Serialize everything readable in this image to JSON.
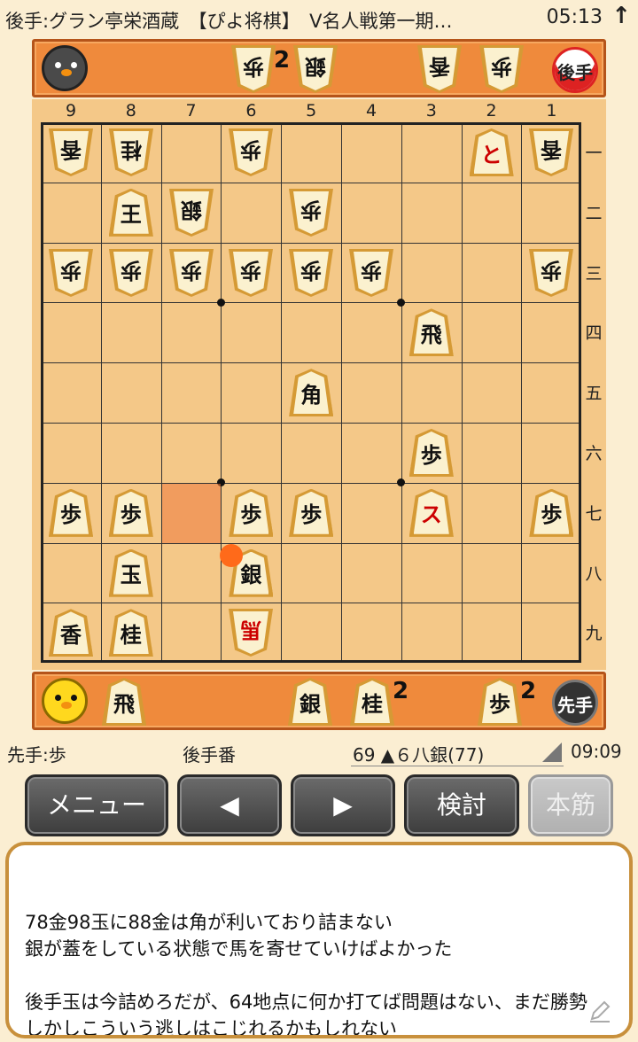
{
  "status_bar": {
    "title": "後手:グラン亭栄酒蔵　【ぴよ将棋】　V名人戦第一期…",
    "time": "05:13",
    "up_icon": "up-arrow-icon"
  },
  "gote": {
    "badge": "後手",
    "hand": [
      {
        "piece": "歩",
        "count": "2"
      },
      {
        "piece": "銀",
        "count": ""
      },
      {
        "piece": "香",
        "count": ""
      },
      {
        "piece": "歩",
        "count": ""
      }
    ]
  },
  "sente": {
    "badge": "先手",
    "hand": [
      {
        "piece": "飛",
        "count": ""
      },
      {
        "piece": "銀",
        "count": ""
      },
      {
        "piece": "桂",
        "count": "2"
      },
      {
        "piece": "歩",
        "count": "2"
      }
    ]
  },
  "board": {
    "files": [
      "9",
      "8",
      "7",
      "6",
      "5",
      "4",
      "3",
      "2",
      "1"
    ],
    "ranks": [
      "一",
      "二",
      "三",
      "四",
      "五",
      "六",
      "七",
      "八",
      "九"
    ],
    "pieces": [
      {
        "file": 9,
        "rank": 1,
        "text": "香",
        "owner": "gote"
      },
      {
        "file": 8,
        "rank": 1,
        "text": "桂",
        "owner": "gote"
      },
      {
        "file": 6,
        "rank": 1,
        "text": "歩",
        "owner": "gote"
      },
      {
        "file": 2,
        "rank": 1,
        "text": "と",
        "owner": "sente",
        "promoted": true
      },
      {
        "file": 1,
        "rank": 1,
        "text": "香",
        "owner": "gote"
      },
      {
        "file": 8,
        "rank": 2,
        "text": "王",
        "owner": "sente"
      },
      {
        "file": 7,
        "rank": 2,
        "text": "銀",
        "owner": "gote"
      },
      {
        "file": 5,
        "rank": 2,
        "text": "歩",
        "owner": "gote"
      },
      {
        "file": 9,
        "rank": 3,
        "text": "歩",
        "owner": "gote"
      },
      {
        "file": 8,
        "rank": 3,
        "text": "歩",
        "owner": "gote"
      },
      {
        "file": 7,
        "rank": 3,
        "text": "歩",
        "owner": "gote"
      },
      {
        "file": 6,
        "rank": 3,
        "text": "歩",
        "owner": "gote"
      },
      {
        "file": 5,
        "rank": 3,
        "text": "歩",
        "owner": "gote"
      },
      {
        "file": 4,
        "rank": 3,
        "text": "歩",
        "owner": "gote"
      },
      {
        "file": 1,
        "rank": 3,
        "text": "歩",
        "owner": "gote"
      },
      {
        "file": 3,
        "rank": 4,
        "text": "飛",
        "owner": "sente"
      },
      {
        "file": 5,
        "rank": 5,
        "text": "角",
        "owner": "sente"
      },
      {
        "file": 3,
        "rank": 6,
        "text": "歩",
        "owner": "sente"
      },
      {
        "file": 9,
        "rank": 7,
        "text": "歩",
        "owner": "sente"
      },
      {
        "file": 8,
        "rank": 7,
        "text": "歩",
        "owner": "sente"
      },
      {
        "file": 6,
        "rank": 7,
        "text": "歩",
        "owner": "sente"
      },
      {
        "file": 5,
        "rank": 7,
        "text": "歩",
        "owner": "sente"
      },
      {
        "file": 3,
        "rank": 7,
        "text": "ス",
        "owner": "sente",
        "promoted": true
      },
      {
        "file": 1,
        "rank": 7,
        "text": "歩",
        "owner": "sente"
      },
      {
        "file": 8,
        "rank": 8,
        "text": "玉",
        "owner": "sente"
      },
      {
        "file": 6,
        "rank": 8,
        "text": "銀",
        "owner": "sente"
      },
      {
        "file": 9,
        "rank": 9,
        "text": "香",
        "owner": "sente"
      },
      {
        "file": 8,
        "rank": 9,
        "text": "桂",
        "owner": "sente"
      },
      {
        "file": 6,
        "rank": 9,
        "text": "馬",
        "owner": "gote",
        "promoted": true
      }
    ],
    "highlight": {
      "file": 7,
      "rank": 7
    },
    "colors": {
      "board": "#f4c888",
      "highlight": "#ee783c",
      "tray": "#ef8a3c"
    }
  },
  "info": {
    "hand_text": "先手:歩",
    "turn_text": "後手番",
    "move_text": "69 ▲６八銀(77)",
    "clock": "09:09"
  },
  "buttons": {
    "menu": "メニュー",
    "prev": "◀",
    "next": "▶",
    "analyze": "検討",
    "mainline": "本筋"
  },
  "comment": "78金98玉に88金は角が利いており詰まない\n銀が蓋をしている状態で馬を寄せていけばよかった\n\n後手玉は今詰めろだが、64地点に何か打てば問題はない、まだ勝勢\nしかしこういう逃しはこじれるかもしれない",
  "icons": {
    "edit": "pencil-icon"
  }
}
